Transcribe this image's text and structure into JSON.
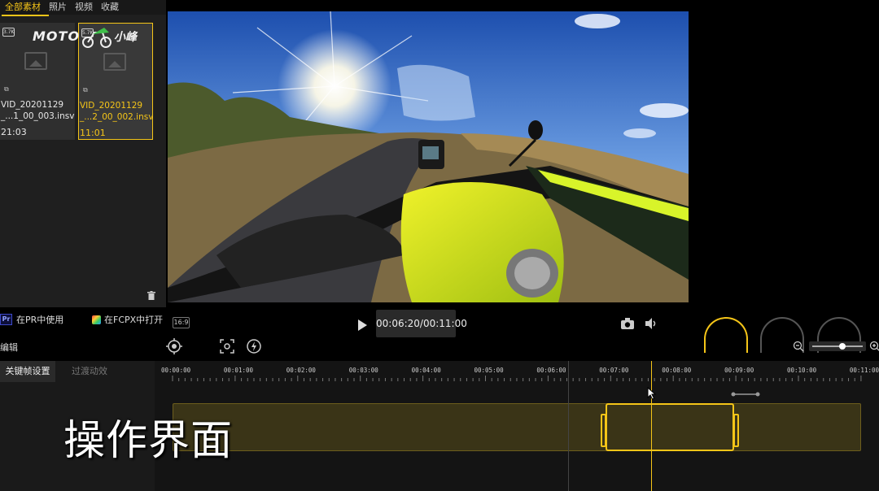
{
  "library": {
    "tabs": [
      {
        "label": "全部素材",
        "active": true
      },
      {
        "label": "照片",
        "active": false
      },
      {
        "label": "视频",
        "active": false
      },
      {
        "label": "收藏",
        "active": false
      }
    ],
    "watermark": {
      "brand": "MOTO",
      "suffix": "小峰"
    },
    "items": [
      {
        "badge": "3.7K",
        "filename": "VID_20201129_...1_00_003.insv",
        "duration": "21:03",
        "selected": false
      },
      {
        "badge": "5.7K",
        "filename": "VID_20201129_...2_00_002.insv",
        "duration": "11:01",
        "selected": true
      }
    ]
  },
  "toolbar": {
    "pr_logo": "Pr",
    "pr_label": "在PR中使用",
    "fcpx_label": "在FCPX中打开",
    "ratio": "16:9",
    "timecode": "00:06:20/00:11:00",
    "edit_label": "编辑",
    "zoom_level": 0.6
  },
  "keyframe_panel": {
    "tab_keyframe": "关键帧设置",
    "tab_transition": "过渡动效"
  },
  "timeline": {
    "ticks": [
      "00:00:00",
      "00:01:00",
      "00:02:00",
      "00:03:00",
      "00:04:00",
      "00:05:00",
      "00:06:00",
      "00:07:00",
      "00:08:00",
      "00:09:00",
      "00:10:00",
      "00:11:00"
    ],
    "playhead_time": "00:07:40",
    "marker_time": "00:06:20"
  },
  "caption": "操作界面",
  "colors": {
    "accent": "#f5c518",
    "panel": "#1f1f1f",
    "timeline_bg": "#141414"
  }
}
